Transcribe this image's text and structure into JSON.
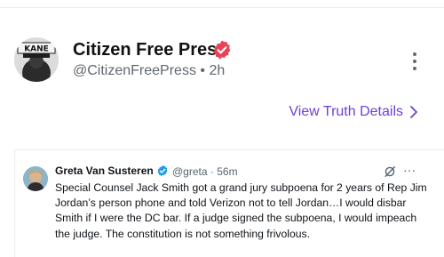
{
  "post": {
    "author_name": "Citizen Free Press",
    "handle": "@CitizenFreePress",
    "separator": "•",
    "time": "2h",
    "avatar_label": "KANE",
    "view_details_label": "View Truth Details",
    "colors": {
      "verified": "#e94257",
      "link": "#6d40d6",
      "muted": "#606770"
    }
  },
  "embedded_tweet": {
    "author_name": "Greta Van Susteren",
    "handle": "@greta",
    "separator": "·",
    "time": "56m",
    "more_label": "···",
    "text": "Special Counsel Jack Smith got a grand jury subpoena for 2 years of Rep Jim Jordan’s person phone and told Verizon not to tell Jordan…I would disbar Smith if I were the DC bar.  If a judge signed the subpoena, I would impeach the judge. The constitution is not something frivolous.",
    "colors": {
      "verified": "#1d9bf0",
      "muted": "#536471"
    }
  }
}
